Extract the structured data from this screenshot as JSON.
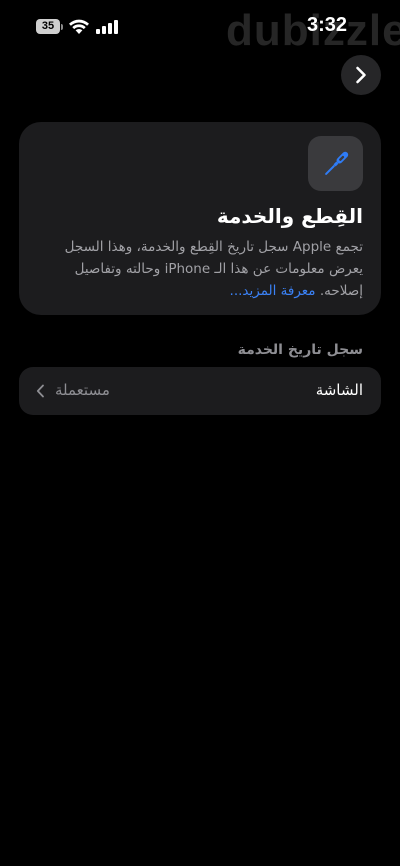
{
  "status_bar": {
    "battery_level": "35",
    "time": "3:32",
    "watermark": "dubizzle",
    "icons": [
      "battery-icon",
      "wifi-icon",
      "signal-icon"
    ]
  },
  "nav": {
    "forward_icon": "chevron-right-icon"
  },
  "info_card": {
    "icon": "screwdriver-icon",
    "title": "القِطع والخدمة",
    "body": "تجمع Apple سجل تاريخ القِطع والخدمة، وهذا السجل يعرض معلومات عن هذا الـ iPhone وحالته وتفاصيل إصلاحه.",
    "link": "معرفة المزيد..."
  },
  "service_history": {
    "header": "سجل تاريخ الخدمة",
    "rows": [
      {
        "label": "الشاشة",
        "value": "مستعملة",
        "chevron_icon": "chevron-left-icon"
      }
    ]
  },
  "colors": {
    "background": "#000000",
    "card": "#1c1c1e",
    "link": "#3b82f6",
    "icon_accent": "#2f7cf6",
    "secondary_text": "#8e8e93"
  }
}
